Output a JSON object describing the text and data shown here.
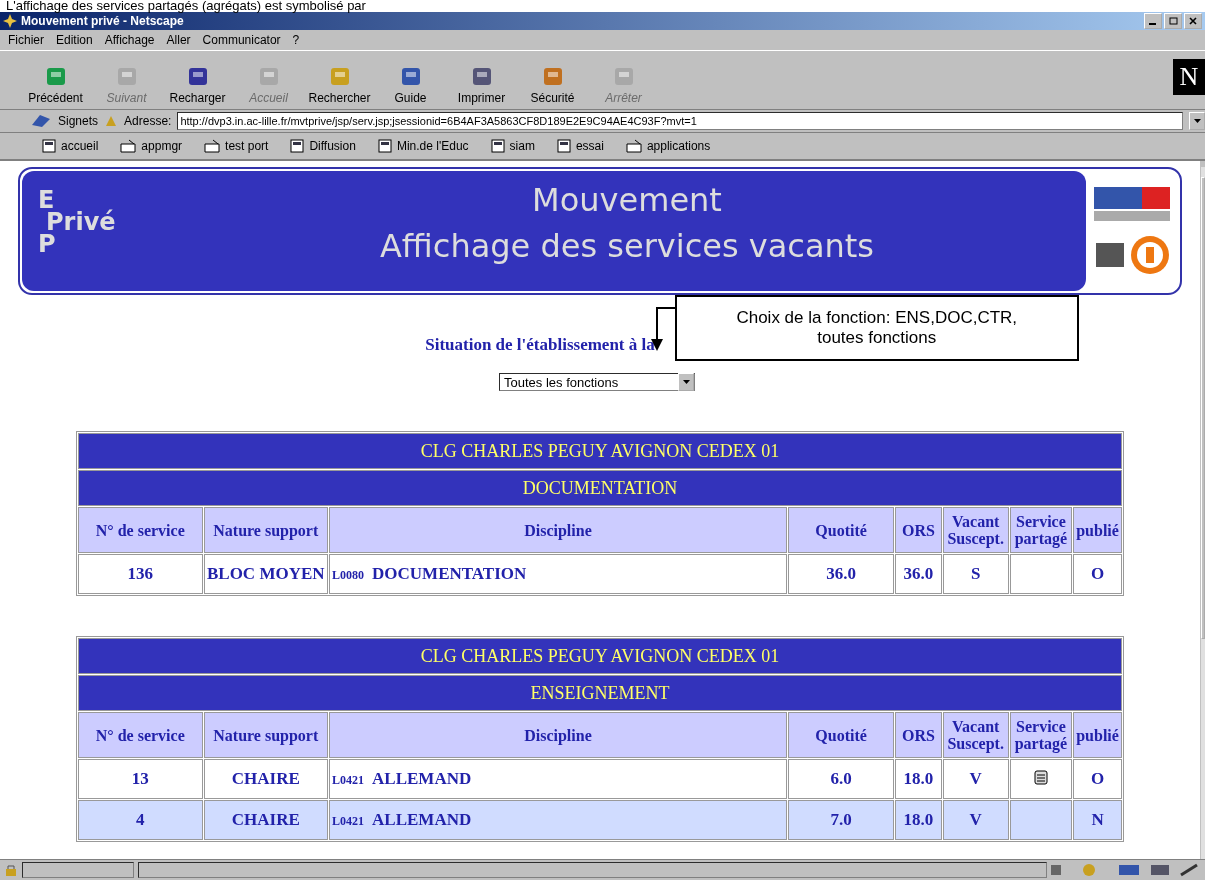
{
  "caption": "L'affichage des services partagés (agrégats) est symbolisé par",
  "window": {
    "title": "Mouvement privé - Netscape"
  },
  "menu": [
    "Fichier",
    "Edition",
    "Affichage",
    "Aller",
    "Communicator",
    "?"
  ],
  "toolbar": [
    {
      "label": "Précédent",
      "disabled": false
    },
    {
      "label": "Suivant",
      "disabled": true
    },
    {
      "label": "Recharger",
      "disabled": false
    },
    {
      "label": "Accueil",
      "disabled": true
    },
    {
      "label": "Rechercher",
      "disabled": false
    },
    {
      "label": "Guide",
      "disabled": false
    },
    {
      "label": "Imprimer",
      "disabled": false
    },
    {
      "label": "Sécurité",
      "disabled": false
    },
    {
      "label": "Arrêter",
      "disabled": true
    }
  ],
  "brand_logo": "N",
  "location": {
    "bookmarks_label": "Signets",
    "address_label": "Adresse:",
    "url": "http://dvp3.in.ac-lille.fr/mvtprive/jsp/serv.jsp;jsessionid=6B4AF3A5863CF8D189E2E9C94AE4C93F?mvt=1"
  },
  "personal_toolbar": [
    {
      "label": "accueil",
      "kind": "page"
    },
    {
      "label": "appmgr",
      "kind": "folder"
    },
    {
      "label": "test port",
      "kind": "folder"
    },
    {
      "label": "Diffusion",
      "kind": "page"
    },
    {
      "label": "Min.de l'Educ",
      "kind": "page"
    },
    {
      "label": "siam",
      "kind": "page"
    },
    {
      "label": "essai",
      "kind": "page"
    },
    {
      "label": "applications",
      "kind": "folder"
    }
  ],
  "banner": {
    "logo_lines": [
      "E",
      "Privé",
      "P"
    ],
    "title": "Mouvement",
    "subtitle": "Affichage des services vacants"
  },
  "situation": "Situation de l'établissement à la",
  "function_select": {
    "value": "Toutes les fonctions"
  },
  "callout": "Choix de la fonction: ENS,DOC,CTR, toutes fonctions",
  "sections": [
    {
      "school": "CLG CHARLES PEGUY AVIGNON CEDEX 01",
      "function": "DOCUMENTATION",
      "columns": [
        "N° de service",
        "Nature support",
        "Discipline",
        "Quotité",
        "ORS",
        "Vacant Suscept.",
        "Service partagé",
        "publié"
      ],
      "rows": [
        {
          "number": "136",
          "support": "BLOC MOYEN",
          "code": "L0080",
          "discipline": "DOCUMENTATION",
          "quotite": "36.0",
          "ors": "36.0",
          "vacant": "S",
          "shared": false,
          "publie": "O",
          "highlighted": false
        }
      ]
    },
    {
      "school": "CLG CHARLES PEGUY AVIGNON CEDEX 01",
      "function": "ENSEIGNEMENT",
      "columns": [
        "N° de service",
        "Nature support",
        "Discipline",
        "Quotité",
        "ORS",
        "Vacant Suscept.",
        "Service partagé",
        "publié"
      ],
      "rows": [
        {
          "number": "13",
          "support": "CHAIRE",
          "code": "L0421",
          "discipline": "ALLEMAND",
          "quotite": "6.0",
          "ors": "18.0",
          "vacant": "V",
          "shared": true,
          "publie": "O",
          "highlighted": false
        },
        {
          "number": "4",
          "support": "CHAIRE",
          "code": "L0421",
          "discipline": "ALLEMAND",
          "quotite": "7.0",
          "ors": "18.0",
          "vacant": "V",
          "shared": false,
          "publie": "N",
          "highlighted": true
        }
      ]
    }
  ]
}
